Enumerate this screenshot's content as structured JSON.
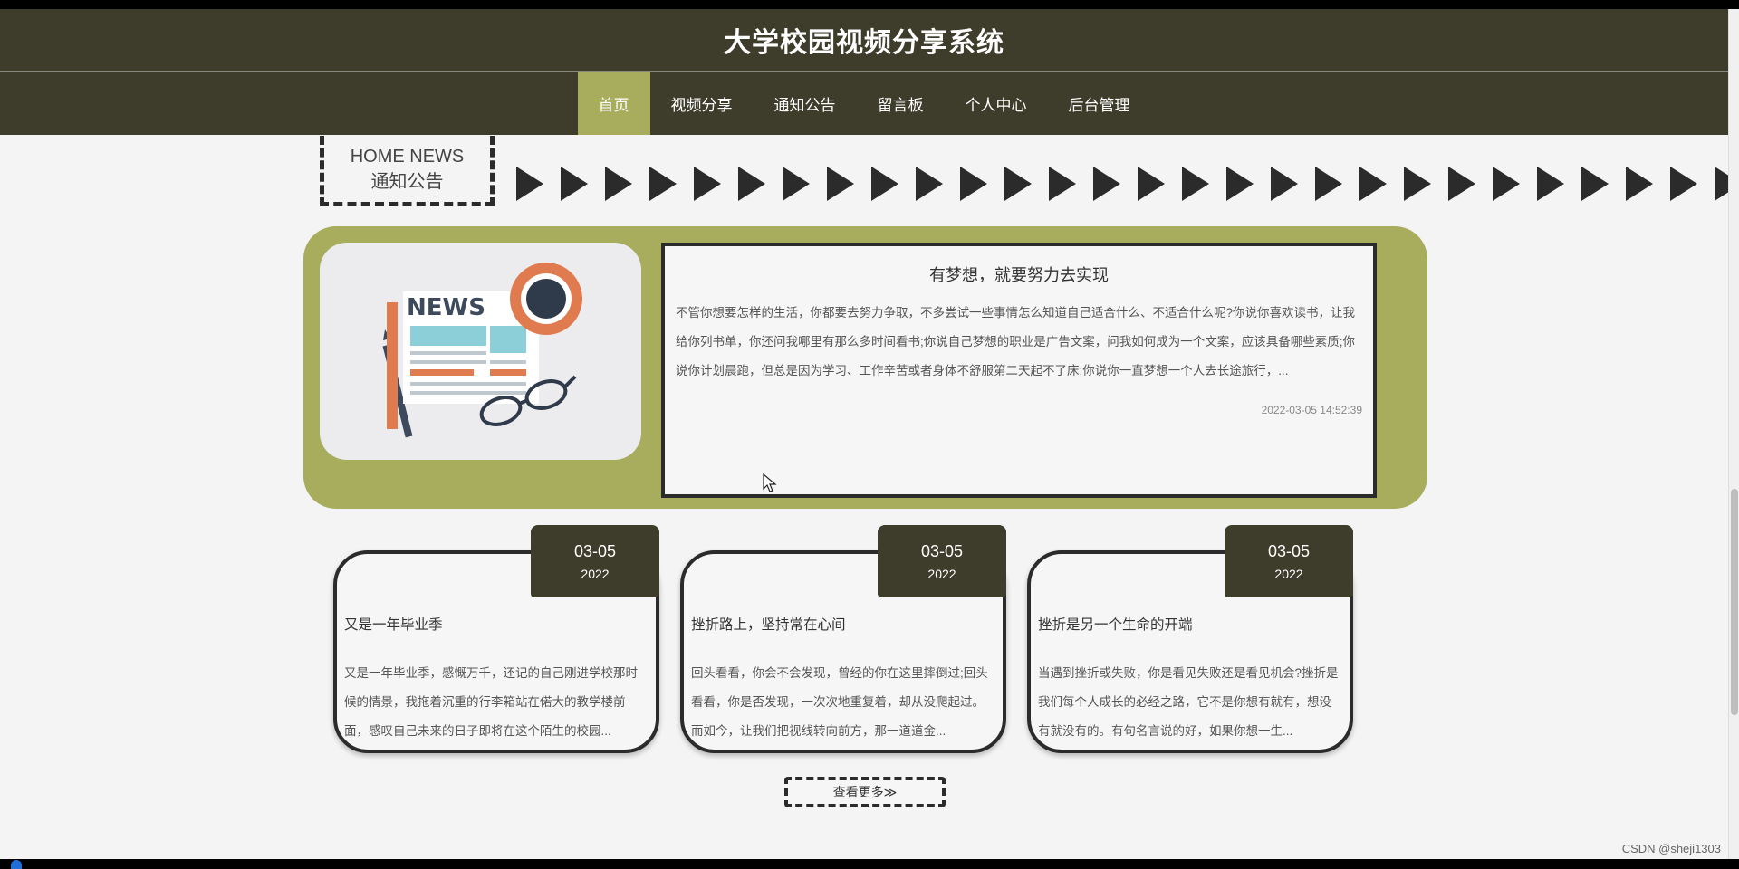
{
  "header": {
    "title": "大学校园视频分享系统"
  },
  "nav": {
    "items": [
      {
        "label": "首页"
      },
      {
        "label": "视频分享"
      },
      {
        "label": "通知公告"
      },
      {
        "label": "留言板"
      },
      {
        "label": "个人中心"
      },
      {
        "label": "后台管理"
      }
    ],
    "active_index": 0
  },
  "news_section": {
    "heading_en": "HOME NEWS",
    "heading_cn": "通知公告",
    "image_text": "NEWS"
  },
  "featured": {
    "title": "有梦想，就要努力去实现",
    "body": "不管你想要怎样的生活，你都要去努力争取，不多尝试一些事情怎么知道自己适合什么、不适合什么呢?你说你喜欢读书，让我给你列书单，你还问我哪里有那么多时间看书;你说自己梦想的职业是广告文案，问我如何成为一个文案，应该具备哪些素质;你说你计划晨跑，但总是因为学习、工作辛苦或者身体不舒服第二天起不了床;你说你一直梦想一个人去长途旅行，...",
    "date": "2022-03-05 14:52:39"
  },
  "cards": [
    {
      "date_md": "03-05",
      "date_year": "2022",
      "title": "又是一年毕业季",
      "body": "又是一年毕业季，感慨万千，还记的自己刚进学校那时候的情景，我拖着沉重的行李箱站在偌大的教学楼前面，感叹自己未来的日子即将在这个陌生的校园..."
    },
    {
      "date_md": "03-05",
      "date_year": "2022",
      "title": "挫折路上，坚持常在心间",
      "body": "回头看看，你会不会发现，曾经的你在这里摔倒过;回头看看，你是否发现，一次次地重复着，却从没爬起过。而如今，让我们把视线转向前方，那一道道金..."
    },
    {
      "date_md": "03-05",
      "date_year": "2022",
      "title": "挫折是另一个生命的开端",
      "body": "当遇到挫折或失败，你是看见失败还是看见机会?挫折是我们每个人成长的必经之路，它不是你想有就有，想没有就没有的。有句名言说的好，如果你想一生..."
    }
  ],
  "more_button": {
    "label": "查看更多≫"
  },
  "watermark": "CSDN @sheji1303",
  "colors": {
    "header_bg": "#3e3d2c",
    "accent": "#a8ad5e",
    "border": "#2b2b2b"
  }
}
